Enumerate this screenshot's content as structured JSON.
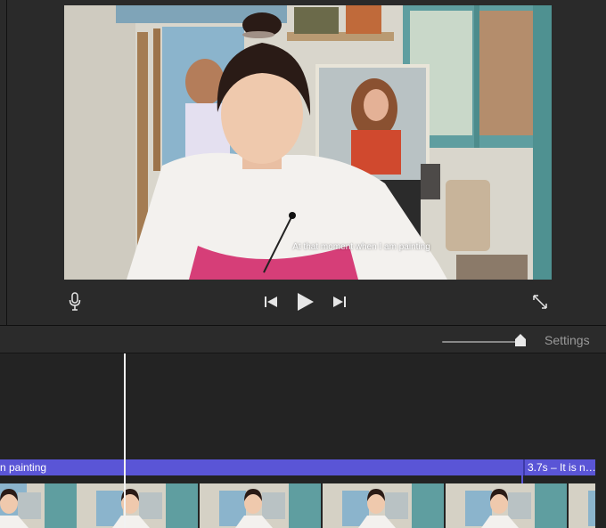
{
  "video": {
    "subtitle": "At that moment when I am painting"
  },
  "controls": {
    "mic_icon": "microphone-icon",
    "prev_icon": "skip-back-icon",
    "play_icon": "play-icon",
    "next_icon": "skip-forward-icon",
    "fullscreen_icon": "expand-icon"
  },
  "toolbar": {
    "zoom_level": 0.95,
    "settings_label": "Settings"
  },
  "timeline": {
    "title_clip_1": "n painting",
    "title_clip_2": "3.7s – It is n…",
    "thumbnail_count": 5
  }
}
